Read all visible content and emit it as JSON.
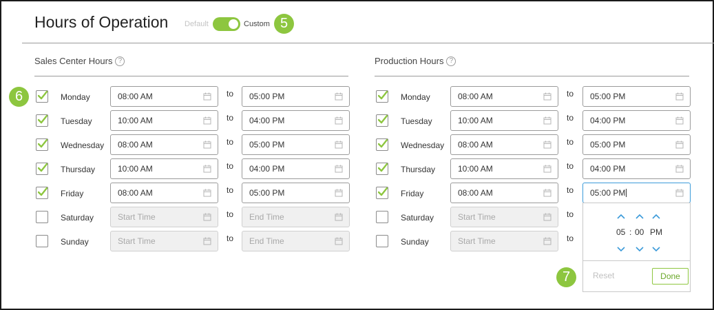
{
  "header": {
    "title": "Hours of Operation",
    "default_label": "Default",
    "custom_label": "Custom",
    "toggle_state": "custom"
  },
  "badges": {
    "b5": "5",
    "b6": "6",
    "b7": "7"
  },
  "sales": {
    "title": "Sales Center Hours",
    "rows": [
      {
        "day": "Monday",
        "checked": true,
        "from": "08:00 AM",
        "to": "05:00 PM"
      },
      {
        "day": "Tuesday",
        "checked": true,
        "from": "10:00 AM",
        "to": "04:00 PM"
      },
      {
        "day": "Wednesday",
        "checked": true,
        "from": "08:00 AM",
        "to": "05:00 PM"
      },
      {
        "day": "Thursday",
        "checked": true,
        "from": "10:00 AM",
        "to": "04:00 PM"
      },
      {
        "day": "Friday",
        "checked": true,
        "from": "08:00 AM",
        "to": "05:00 PM"
      },
      {
        "day": "Saturday",
        "checked": false,
        "from": "Start Time",
        "to": "End Time"
      },
      {
        "day": "Sunday",
        "checked": false,
        "from": "Start Time",
        "to": "End Time"
      }
    ]
  },
  "production": {
    "title": "Production Hours",
    "rows": [
      {
        "day": "Monday",
        "checked": true,
        "from": "08:00 AM",
        "to": "05:00 PM"
      },
      {
        "day": "Tuesday",
        "checked": true,
        "from": "10:00 AM",
        "to": "04:00 PM"
      },
      {
        "day": "Wednesday",
        "checked": true,
        "from": "08:00 AM",
        "to": "05:00 PM"
      },
      {
        "day": "Thursday",
        "checked": true,
        "from": "10:00 AM",
        "to": "04:00 PM"
      },
      {
        "day": "Friday",
        "checked": true,
        "from": "08:00 AM",
        "to": "05:00 PM"
      },
      {
        "day": "Saturday",
        "checked": false,
        "from": "Start Time",
        "to": ""
      },
      {
        "day": "Sunday",
        "checked": false,
        "from": "Start Time",
        "to": ""
      }
    ]
  },
  "to_label": "to",
  "help_glyph": "?",
  "picker": {
    "hour": "05",
    "separator": ":",
    "minute": "00",
    "meridiem": "PM",
    "reset_label": "Reset",
    "done_label": "Done"
  },
  "colors": {
    "accent": "#8dc63f",
    "focus_border": "#3a9ad9",
    "arrow": "#3a9ad9"
  }
}
